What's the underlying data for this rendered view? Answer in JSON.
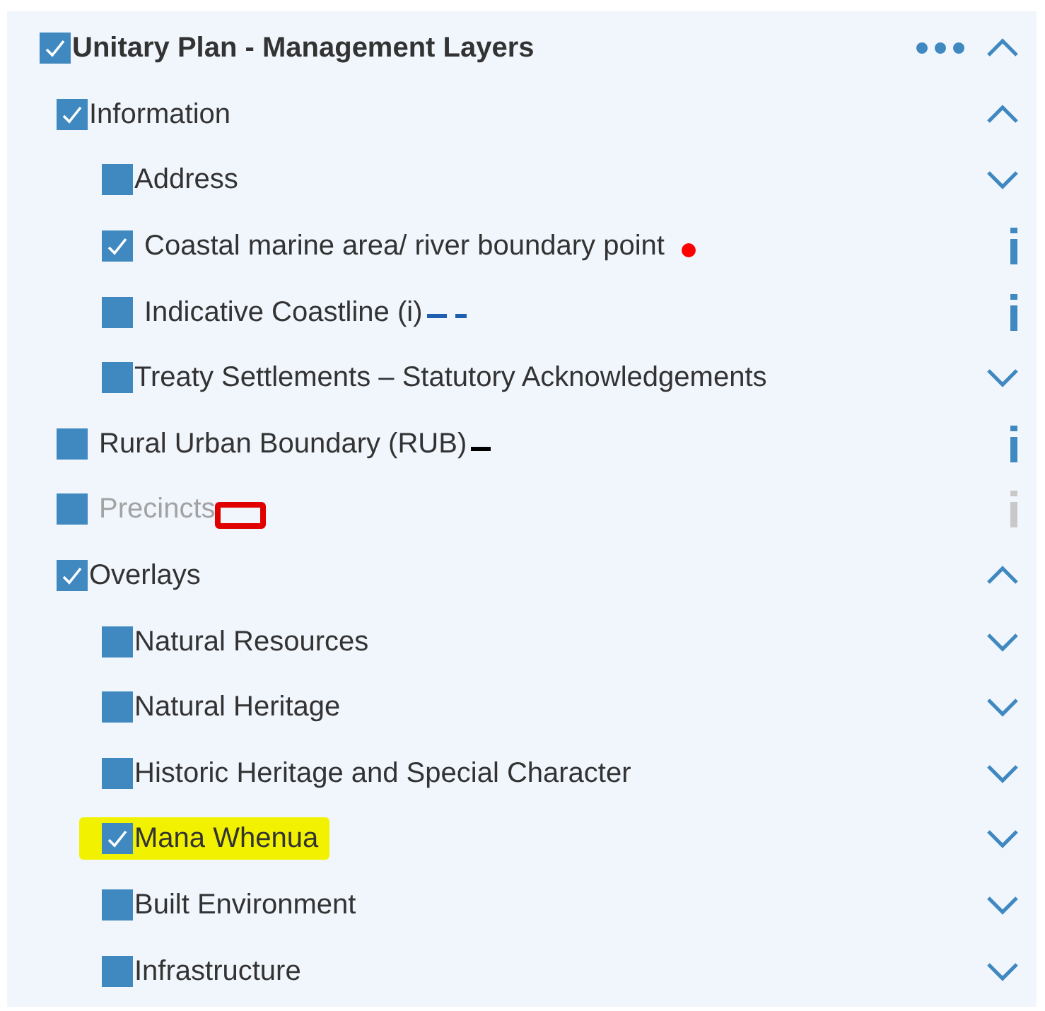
{
  "layer_tree": {
    "label": "Unitary Plan - Management Layers",
    "checked": true,
    "more_menu": true,
    "expanded": true,
    "children": [
      {
        "kind": "group",
        "label": "Information",
        "checked": true,
        "expanded": true,
        "children": [
          {
            "kind": "group",
            "label": "Address",
            "checked": false,
            "expanded": false
          },
          {
            "kind": "layer",
            "label": "Coastal marine area/ river boundary point",
            "checked": true,
            "legend": {
              "kind": "dot",
              "color": "#ff0000"
            }
          },
          {
            "kind": "layer",
            "label": "Indicative Coastline (i)",
            "checked": false,
            "legend": {
              "kind": "dash",
              "color": "#1f5fb0"
            }
          },
          {
            "kind": "group",
            "label": "Treaty Settlements – Statutory Acknowledgements",
            "checked": false,
            "expanded": false
          }
        ]
      },
      {
        "kind": "layer",
        "label": "Rural Urban Boundary (RUB)",
        "checked": false,
        "legend": {
          "kind": "line",
          "color": "#000000"
        }
      },
      {
        "kind": "layer",
        "label": "Precincts",
        "checked": false,
        "disabled": true,
        "legend": {
          "kind": "rect",
          "color": "#e00000"
        }
      },
      {
        "kind": "group",
        "label": "Overlays",
        "checked": true,
        "expanded": true,
        "children": [
          {
            "kind": "group",
            "label": "Natural Resources",
            "checked": false,
            "expanded": false
          },
          {
            "kind": "group",
            "label": "Natural Heritage",
            "checked": false,
            "expanded": false
          },
          {
            "kind": "group",
            "label": "Historic Heritage and Special Character",
            "checked": false,
            "expanded": false
          },
          {
            "kind": "group",
            "label": "Mana Whenua",
            "checked": true,
            "expanded": false,
            "highlighted": true
          },
          {
            "kind": "group",
            "label": "Built Environment",
            "checked": false,
            "expanded": false
          },
          {
            "kind": "group",
            "label": "Infrastructure",
            "checked": false,
            "expanded": false
          }
        ]
      }
    ]
  }
}
